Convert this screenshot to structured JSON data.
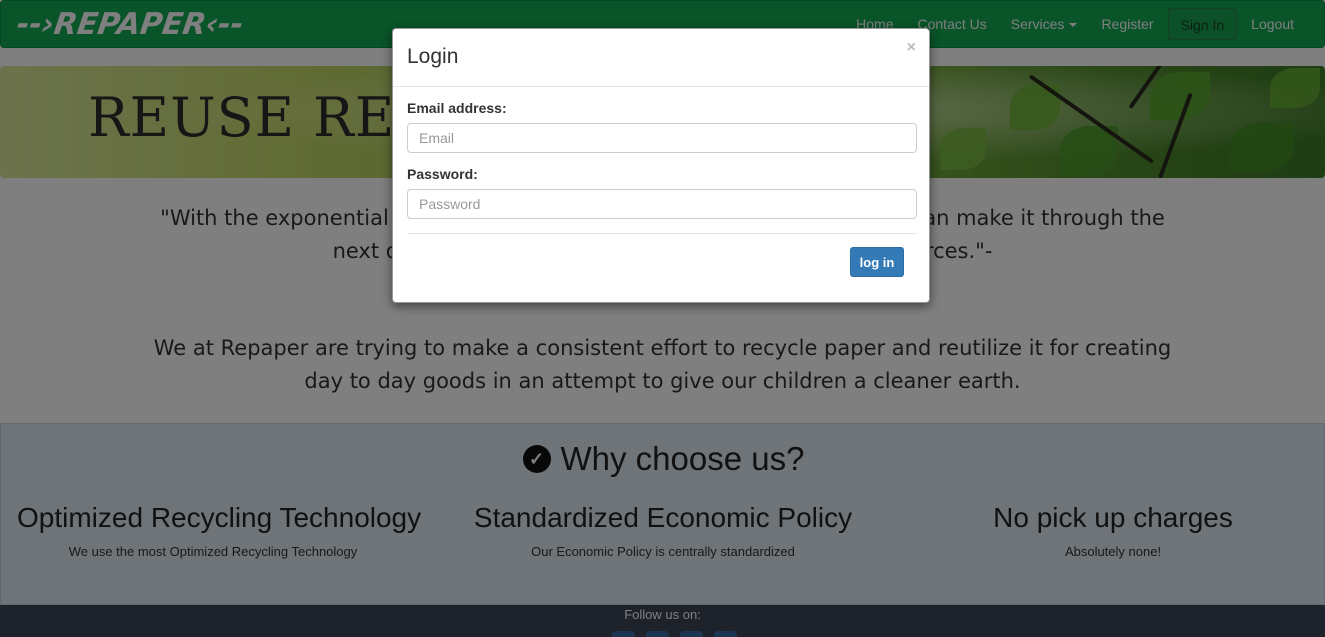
{
  "navbar": {
    "logo_text": "--›REPAPER‹--",
    "links": {
      "home": "Home",
      "contact": "Contact Us",
      "services": "Services",
      "register": "Register",
      "signin": "Sign In",
      "logout": "Logout"
    }
  },
  "banner": {
    "title": "REUSE REDUCE RECYCLE"
  },
  "quote": "\"With the exponential increase in paper consumption, the only way we can make it through the next decade is by recycling and reusing our paper resources.\"-",
  "mission": "We at Repaper are trying to make a consistent effort to recycle paper and reutilize it for creating day to day goods in an attempt to give our children a cleaner earth.",
  "why": {
    "title": "Why choose us?",
    "icon": "check-circle-icon",
    "features": [
      {
        "title": "Optimized Recycling Technology",
        "desc": "We use the most Optimized Recycling Technology"
      },
      {
        "title": "Standardized Economic Policy",
        "desc": "Our Economic Policy is centrally standardized"
      },
      {
        "title": "No pick up charges",
        "desc": "Absolutely none!"
      }
    ]
  },
  "footer": {
    "follow": "Follow us on:",
    "social_icons": [
      "facebook-icon",
      "twitter-icon",
      "linkedin-icon",
      "instagram-icon"
    ]
  },
  "modal": {
    "title": "Login",
    "close_glyph": "×",
    "email_label": "Email address:",
    "email_placeholder": "Email",
    "email_value": "",
    "password_label": "Password:",
    "password_placeholder": "Password",
    "password_value": "",
    "submit_label": "log in"
  },
  "colors": {
    "navbar": "#13a851",
    "primary_button": "#337ab7",
    "why_background": "#dfe8f1",
    "footer": "#3a4556"
  }
}
